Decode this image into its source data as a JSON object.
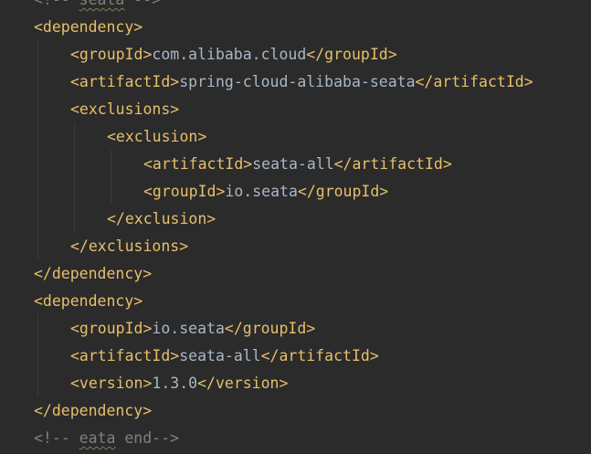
{
  "editor": {
    "lines": [
      {
        "parts": [
          {
            "cls": "comment",
            "t": "<!-- "
          },
          {
            "cls": "comment squiggle",
            "t": "seata"
          },
          {
            "cls": "comment",
            "t": " -->"
          }
        ]
      },
      {
        "parts": [
          {
            "cls": "tag",
            "t": "<dependency>"
          }
        ]
      },
      {
        "parts": [
          {
            "cls": "tag",
            "t": "<groupId>"
          },
          {
            "cls": "text",
            "t": "com.alibaba.cloud"
          },
          {
            "cls": "tag",
            "t": "</groupId>"
          }
        ]
      },
      {
        "parts": [
          {
            "cls": "tag",
            "t": "<artifactId>"
          },
          {
            "cls": "text",
            "t": "spring-cloud-alibaba-seata"
          },
          {
            "cls": "tag",
            "t": "</artifactId>"
          }
        ]
      },
      {
        "parts": [
          {
            "cls": "tag",
            "t": "<exclusions>"
          }
        ]
      },
      {
        "parts": [
          {
            "cls": "tag",
            "t": "<exclusion>"
          }
        ]
      },
      {
        "parts": [
          {
            "cls": "tag",
            "t": "<artifactId>"
          },
          {
            "cls": "text",
            "t": "seata-all"
          },
          {
            "cls": "tag",
            "t": "</artifactId>"
          }
        ]
      },
      {
        "parts": [
          {
            "cls": "tag",
            "t": "<groupId>"
          },
          {
            "cls": "text",
            "t": "io.seata"
          },
          {
            "cls": "tag",
            "t": "</groupId>"
          }
        ]
      },
      {
        "parts": [
          {
            "cls": "tag",
            "t": "</exclusion>"
          }
        ]
      },
      {
        "parts": [
          {
            "cls": "tag",
            "t": "</exclusions>"
          }
        ]
      },
      {
        "parts": [
          {
            "cls": "tag",
            "t": "</dependency>"
          }
        ]
      },
      {
        "parts": [
          {
            "cls": "tag",
            "t": "<dependency>"
          }
        ]
      },
      {
        "parts": [
          {
            "cls": "tag",
            "t": "<groupId>"
          },
          {
            "cls": "text",
            "t": "io.seata"
          },
          {
            "cls": "tag",
            "t": "</groupId>"
          }
        ]
      },
      {
        "parts": [
          {
            "cls": "tag",
            "t": "<artifactId>"
          },
          {
            "cls": "text",
            "t": "seata-all"
          },
          {
            "cls": "tag",
            "t": "</artifactId>"
          }
        ]
      },
      {
        "parts": [
          {
            "cls": "tag",
            "t": "<version>"
          },
          {
            "cls": "text",
            "t": "1.3.0"
          },
          {
            "cls": "tag",
            "t": "</version>"
          }
        ]
      },
      {
        "parts": [
          {
            "cls": "tag",
            "t": "</dependency>"
          }
        ]
      },
      {
        "parts": [
          {
            "cls": "comment",
            "t": "<!-- "
          },
          {
            "cls": "comment squiggle",
            "t": "eata"
          },
          {
            "cls": "comment",
            "t": " end-->"
          }
        ]
      }
    ]
  },
  "colors": {
    "background": "#2b2b2b",
    "tag": "#e8bf6a",
    "text": "#a9b7c6",
    "comment": "#808080"
  }
}
